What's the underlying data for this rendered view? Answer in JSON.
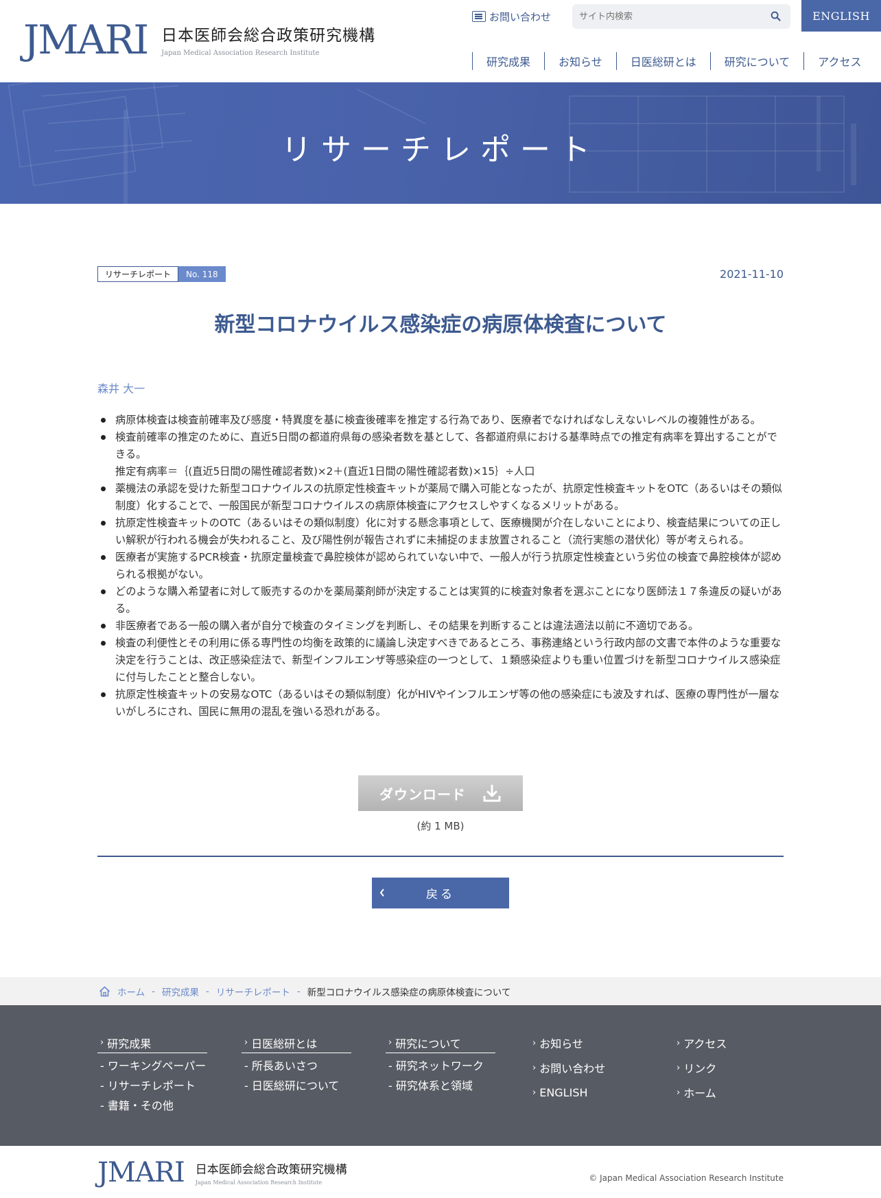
{
  "header": {
    "logo_mark": "JMARI",
    "logo_jp": "日本医師会総合政策研究機構",
    "logo_en": "Japan Medical Association Research Institute",
    "contact_label": "お問い合わせ",
    "search_placeholder": "サイト内検索",
    "english_label": "ENGLISH",
    "nav": [
      "研究成果",
      "お知らせ",
      "日医総研とは",
      "研究について",
      "アクセス"
    ]
  },
  "hero": {
    "title": "リサーチレポート"
  },
  "article": {
    "category": "リサーチレポート",
    "number": "No. 118",
    "date": "2021-11-10",
    "title": "新型コロナウイルス感染症の病原体検査について",
    "author": "森井 大一",
    "points": [
      "病原体検査は検査前確率及び感度・特異度を基に検査後確率を推定する行為であり、医療者でなければなしえないレベルの複雑性がある。",
      "検査前確率の推定のために、直近5日間の都道府県毎の感染者数を基として、各都道府県における基準時点での推定有病率を算出することができる。",
      "薬機法の承認を受けた新型コロナウイルスの抗原定性検査キットが薬局で購入可能となったが、抗原定性検査キットをOTC（あるいはその類似制度）化することで、一般国民が新型コロナウイルスの病原体検査にアクセスしやすくなるメリットがある。",
      "抗原定性検査キットのOTC（あるいはその類似制度）化に対する懸念事項として、医療機関が介在しないことにより、検査結果についての正しい解釈が行われる機会が失われること、及び陽性例が報告されずに未捕捉のまま放置されること（流行実態の潜伏化）等が考えられる。",
      "医療者が実施するPCR検査・抗原定量検査で鼻腔検体が認められていない中で、一般人が行う抗原定性検査という劣位の検査で鼻腔検体が認められる根拠がない。",
      "どのような購入希望者に対して販売するのかを薬局薬剤師が決定することは実質的に検査対象者を選ぶことになり医師法１７条違反の疑いがある。",
      "非医療者である一般の購入者が自分で検査のタイミングを判断し、その結果を判断することは違法適法以前に不適切である。",
      "検査の利便性とその利用に係る専門性の均衡を政策的に議論し決定すべきであるところ、事務連絡という行政内部の文書で本件のような重要な決定を行うことは、改正感染症法で、新型インフルエンザ等感染症の一つとして、１類感染症よりも重い位置づけを新型コロナウイルス感染症に付与したことと整合しない。",
      "抗原定性検査キットの安易なOTC（あるいはその類似制度）化がHIVやインフルエンザ等の他の感染症にも波及すれば、医療の専門性が一層ないがしろにされ、国民に無用の混乱を強いる恐れがある。"
    ],
    "formula": "推定有病率＝｛(直近5日間の陽性確認者数)×2＋(直近1日間の陽性確認者数)×15｝÷人口",
    "download_label": "ダウンロード",
    "file_size": "(約 1 MB)",
    "back_label": "戻る"
  },
  "breadcrumb": {
    "items": [
      "ホーム",
      "研究成果",
      "リサーチレポート"
    ],
    "separator": "-",
    "current": "新型コロナウイルス感染症の病原体検査について"
  },
  "footer": {
    "col1": {
      "title": "研究成果",
      "items": [
        "- ワーキングペーパー",
        "- リサーチレポート",
        "- 書籍・その他"
      ]
    },
    "col2": {
      "title": "日医総研とは",
      "items": [
        "- 所長あいさつ",
        "- 日医総研について"
      ]
    },
    "col3": {
      "title": "研究について",
      "items": [
        "- 研究ネットワーク",
        "- 研究体系と領域"
      ]
    },
    "col4": [
      "お知らせ",
      "お問い合わせ",
      "ENGLISH"
    ],
    "col5": [
      "アクセス",
      "リンク",
      "ホーム"
    ],
    "logo_mark": "JMARI",
    "logo_jp": "日本医師会総合政策研究機構",
    "logo_en": "Japan Medical Association Research Institute",
    "copyright": "© Japan Medical Association Research Institute"
  },
  "colors": {
    "brand": "#3d5a8f",
    "accent": "#4a68a8",
    "badge": "#6b8acb",
    "footer_bg": "#575b63"
  }
}
